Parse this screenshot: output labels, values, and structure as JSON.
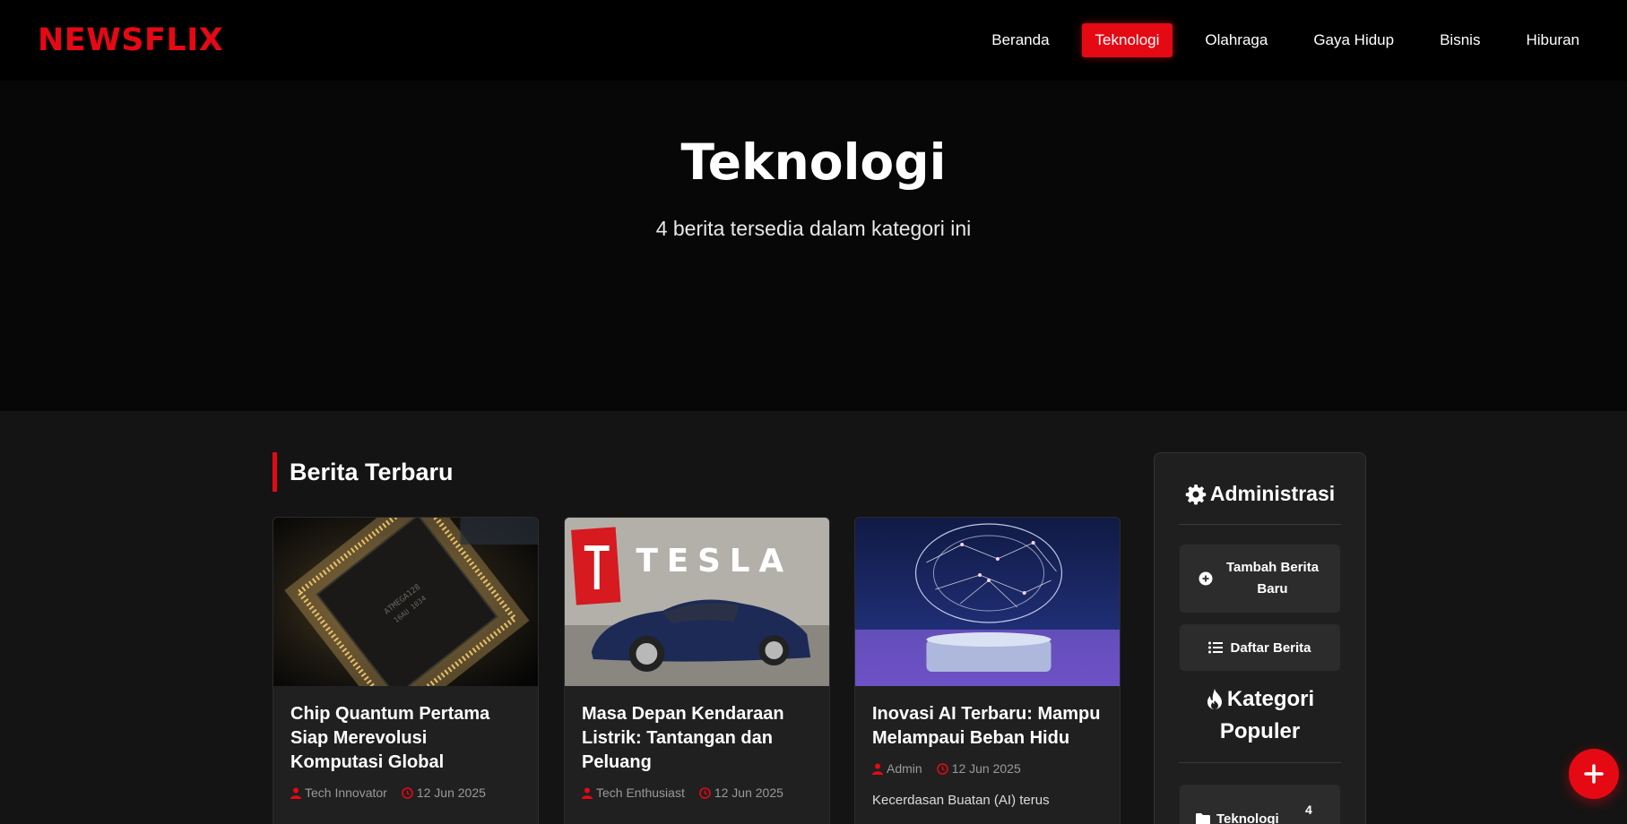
{
  "brand": {
    "logo": "NEWSFLIX"
  },
  "nav": {
    "items": [
      {
        "label": "Beranda"
      },
      {
        "label": "Teknologi"
      },
      {
        "label": "Olahraga"
      },
      {
        "label": "Gaya Hidup"
      },
      {
        "label": "Bisnis"
      },
      {
        "label": "Hiburan"
      }
    ],
    "active": "Teknologi"
  },
  "hero": {
    "title": "Teknologi",
    "subtitle": "4 berita tersedia dalam kategori ini"
  },
  "section": {
    "title": "Berita Terbaru"
  },
  "cards": [
    {
      "title": "Chip Quantum Pertama Siap Merevolusi Komputasi Global",
      "author": "Tech Innovator",
      "date": "12 Jun 2025",
      "excerpt": "",
      "thumb": "processor-chip"
    },
    {
      "title": "Masa Depan Kendaraan Listrik: Tantangan dan Peluang",
      "author": "Tech Enthusiast",
      "date": "12 Jun 2025",
      "excerpt": "",
      "thumb": "tesla-car"
    },
    {
      "title": "Inovasi AI Terbaru: Mampu Melampaui Beban Hidu",
      "author": "Admin",
      "date": "12 Jun 2025",
      "excerpt": "Kecerdasan Buatan (AI) terus",
      "thumb": "ai-brain"
    }
  ],
  "sidebar": {
    "title": "Administrasi",
    "buttons": {
      "add_news": "Tambah Berita Baru",
      "news_list": "Daftar Berita"
    },
    "popular_title_line1": "Kategori",
    "popular_title_line2": "Populer",
    "categories": [
      {
        "label": "Teknologi",
        "count": "4"
      }
    ]
  },
  "colors": {
    "accent": "#e50914",
    "background": "#141414",
    "card": "#202020"
  },
  "icons": [
    "user-icon",
    "clock-icon",
    "gear-icon",
    "plus-circle-icon",
    "list-icon",
    "fire-icon",
    "folder-icon",
    "plus-icon"
  ]
}
